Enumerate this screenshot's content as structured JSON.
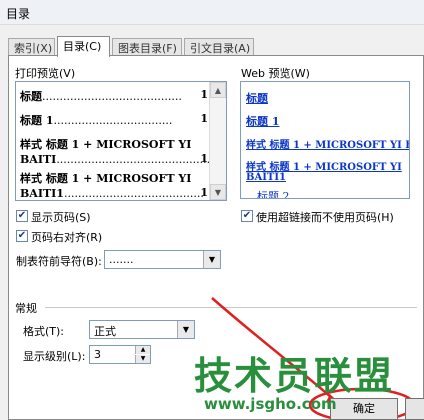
{
  "window": {
    "title": "目录"
  },
  "tabs": [
    "索引(X)",
    "目录(C)",
    "图表目录(F)",
    "引文目录(A)"
  ],
  "print_preview": {
    "label": "打印预览(V)",
    "entries": [
      {
        "text": "标题",
        "dots": "........................................",
        "page": "1"
      },
      {
        "text": "标题 1",
        "dots": "..................................",
        "page": "1"
      },
      {
        "text": "样式 标题 1 + MICROSOFT YI",
        "text2": "BAITI",
        "dots": "............................................",
        "page": "1"
      },
      {
        "text": "样式 标题 1 + MICROSOFT YI",
        "text2": "BAITI1",
        "dots": "........................................",
        "page": "1"
      }
    ]
  },
  "web_preview": {
    "label": "Web 预览(W)",
    "links": [
      "标题",
      "标题 1",
      "样式 标题 1 + MICROSOFT YI BAITI",
      "样式 标题 1 + MICROSOFT YI",
      "BAITI1",
      "标题 2"
    ]
  },
  "options": {
    "show_page_numbers": "显示页码(S)",
    "right_align_page_numbers": "页码右对齐(R)",
    "tab_leader_label": "制表符前导符(B):",
    "tab_leader_value": ".......",
    "use_hyperlinks": "使用超链接而不使用页码(H)"
  },
  "general": {
    "label": "常规",
    "format_label": "格式(T):",
    "format_value": "正式",
    "levels_label": "显示级别(L):",
    "levels_value": "3"
  },
  "buttons": {
    "ok": "确定"
  },
  "watermark": {
    "text": "技术员联盟",
    "url": "www.jsgho.com"
  }
}
